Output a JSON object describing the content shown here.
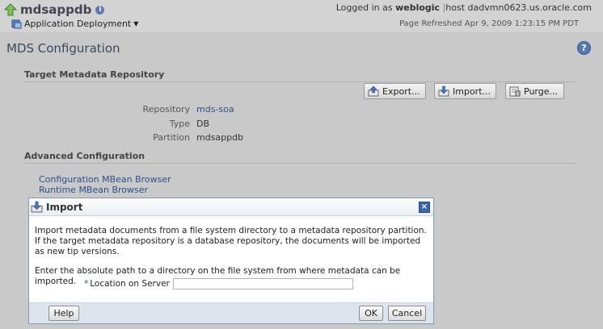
{
  "header": {
    "app_name": "mdsappdb",
    "menu_label": "Application Deployment",
    "logged_in_prefix": "Logged in as",
    "username": "weblogic",
    "host_text": "host dadvmn0623.us.oracle.com",
    "page_refreshed": "Page Refreshed Apr 9, 2009 1:23:15 PM PDT"
  },
  "page": {
    "title": "MDS Configuration"
  },
  "target_repo": {
    "heading": "Target Metadata Repository",
    "export_label": "Export...",
    "import_label": "Import...",
    "purge_label": "Purge...",
    "repository_label": "Repository",
    "repository_value": "mds-soa",
    "type_label": "Type",
    "type_value": "DB",
    "partition_label": "Partition",
    "partition_value": "mdsappdb"
  },
  "advanced": {
    "heading": "Advanced Configuration",
    "links": [
      "Configuration MBean Browser",
      "Runtime MBean Browser"
    ]
  },
  "dialog": {
    "title": "Import",
    "message1": "Import metadata documents from a file system directory to a metadata repository partition. If the target metadata repository is a database repository, the documents will be imported as new tip versions.",
    "message2": "Enter the absolute path to a directory on the file system from where metadata can be imported.",
    "location_label": "Location on Server",
    "location_value": "",
    "help_label": "Help",
    "ok_label": "OK",
    "cancel_label": "Cancel"
  },
  "icons": {
    "up": "up-arrow-icon",
    "info": "info-icon",
    "help": "help-icon",
    "close": "close-icon"
  }
}
